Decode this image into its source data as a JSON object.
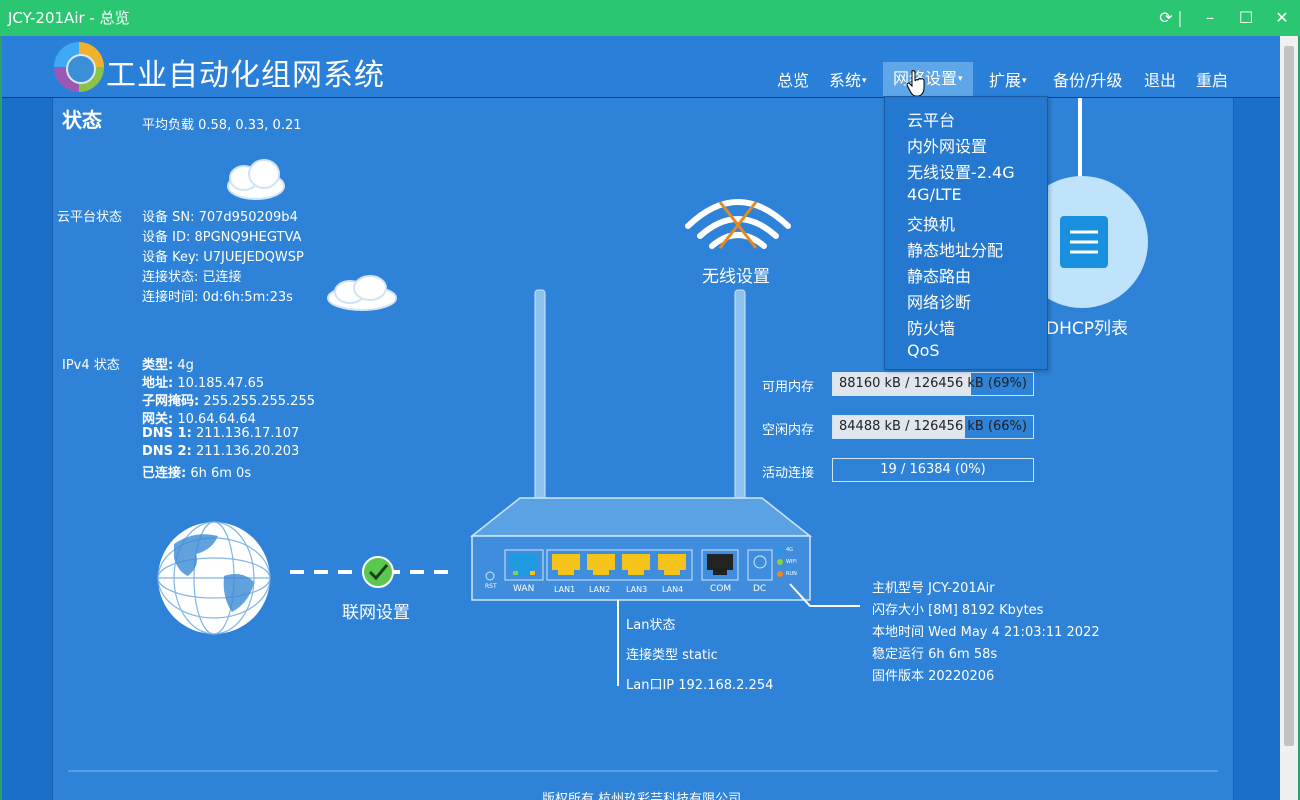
{
  "window": {
    "title": "JCY-201Air  - 总览"
  },
  "brand": {
    "name": "工业自动化组网系统"
  },
  "nav": {
    "overview": "总览",
    "system": "系统",
    "network": "网络设置",
    "extend": "扩展",
    "backup": "备份/升级",
    "logout": "退出",
    "reboot": "重启"
  },
  "dropdown": [
    "云平台",
    "内外网设置",
    "无线设置-2.4G",
    "4G/LTE",
    "交换机",
    "静态地址分配",
    "静态路由",
    "网络诊断",
    "防火墙",
    "QoS"
  ],
  "status": {
    "title": "状态",
    "load": "平均负载 0.58, 0.33, 0.21"
  },
  "cloud": {
    "label": "云平台状态",
    "sn": "设备 SN: 707d950209b4",
    "id": "设备 ID: 8PGNQ9HEGTVA",
    "key": "设备 Key: U7JUEJEDQWSP",
    "state": "连接状态: 已连接",
    "time": "连接时间: 0d:6h:5m:23s"
  },
  "ipv4": {
    "label": "IPv4 状态",
    "type_k": "类型:",
    "type_v": " 4g",
    "addr_k": "地址:",
    "addr_v": " 10.185.47.65",
    "mask_k": "子网掩码:",
    "mask_v": " 255.255.255.255",
    "gw_k": "网关:",
    "gw_v": " 10.64.64.64",
    "dns1_k": "DNS 1:",
    "dns1_v": " 211.136.17.107",
    "dns2_k": "DNS 2:",
    "dns2_v": " 211.136.20.203",
    "conn_k": "已连接:",
    "conn_v": " 6h 6m 0s"
  },
  "wireless": {
    "label": "无线设置"
  },
  "dhcp": {
    "label": "DHCP列表"
  },
  "memory": {
    "avail_label": "可用内存",
    "avail_text": "88160 kB / 126456 kB (69%)",
    "avail_fraction": 0.69,
    "free_label": "空闲内存",
    "free_text": "84488 kB / 126456 kB (66%)",
    "free_fraction": 0.66,
    "conn_label": "活动连接",
    "conn_text": "19 / 16384 (0%)",
    "conn_fraction": 0.0
  },
  "router": {
    "ports": [
      "WAN",
      "LAN1",
      "LAN2",
      "LAN3",
      "LAN4",
      "COM",
      "DC"
    ],
    "rst": "RST",
    "leds": [
      "4G",
      "WIFI",
      "RUN"
    ]
  },
  "internet": {
    "label": "联网设置"
  },
  "lan": {
    "title": "Lan状态",
    "type": "连接类型 static",
    "ip": "Lan口IP 192.168.2.254"
  },
  "device": {
    "model": "主机型号 JCY-201Air",
    "flash": "闪存大小 [8M] 8192 Kbytes",
    "time": "本地时间 Wed May 4 21:03:11 2022",
    "uptime": "稳定运行 6h 6m 58s",
    "firmware": "固件版本 20220206"
  },
  "footer": {
    "copyright": "版权所有 杭州玖彩芸科技有限公司"
  },
  "colors": {
    "titlebar": "#2bc671",
    "background": "#2e82d7",
    "accent": "#f5c41a",
    "check": "#5ac84e"
  }
}
